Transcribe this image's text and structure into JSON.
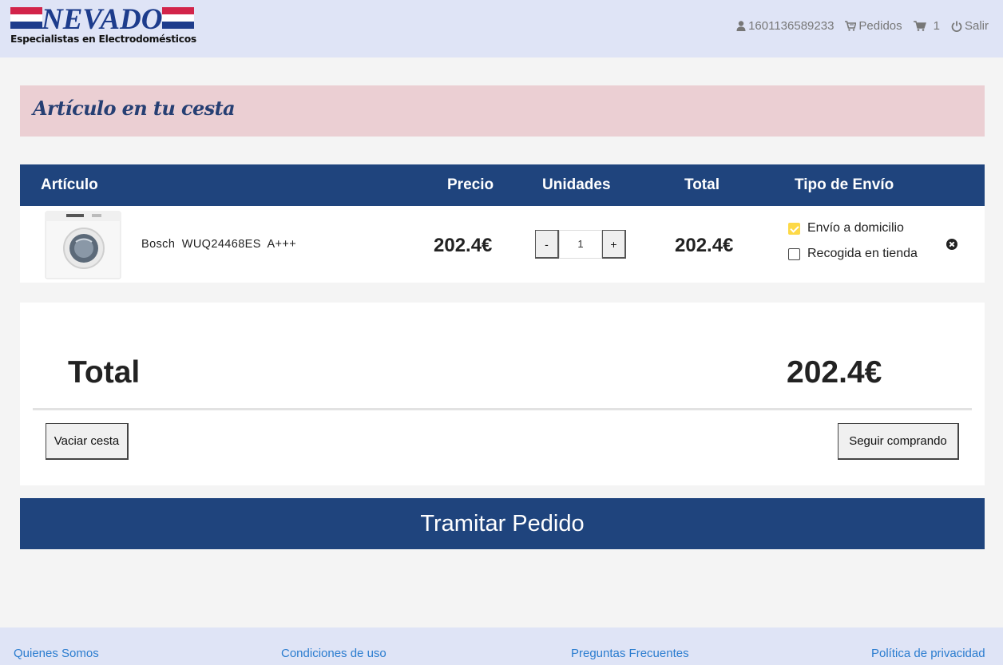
{
  "brand": {
    "name": "NEVADO",
    "tagline": "Especialistas en Electrodomésticos",
    "colors": {
      "red": "#d2244a",
      "blue": "#1d3c8c"
    }
  },
  "top_nav": {
    "user_id": "1601136589233",
    "orders_label": "Pedidos",
    "cart_count": "1",
    "logout_label": "Salir"
  },
  "banner": {
    "title": "Artículo en tu cesta"
  },
  "table": {
    "headers": {
      "article": "Artículo",
      "price": "Precio",
      "units": "Unidades",
      "total": "Total",
      "shipping": "Tipo de Envío"
    },
    "rows": [
      {
        "product_image_icon": "washing-machine-icon",
        "name": "Bosch  WUQ24468ES A+++",
        "price": "202.4€",
        "quantity": "1",
        "minus_label": "-",
        "plus_label": "+",
        "total": "202.4€",
        "shipping_options": [
          {
            "label": "Envío a domicilio",
            "checked": true
          },
          {
            "label": "Recogida en tienda",
            "checked": false
          }
        ]
      }
    ]
  },
  "summary": {
    "total_label": "Total",
    "total_value": "202.4€",
    "empty_cart_label": "Vaciar cesta",
    "continue_label": "Seguir comprando",
    "checkout_label": "Tramitar Pedido"
  },
  "footer": {
    "links": [
      "Quienes Somos",
      "Condiciones de uso",
      "Preguntas Frecuentes",
      "Política de privacidad"
    ]
  },
  "colors": {
    "header_bg": "#dfe4f6",
    "primary": "#1f447d",
    "banner_bg": "#ebcfd3",
    "checkbox_checked": "#fdd947",
    "link": "#2a7ccf"
  }
}
